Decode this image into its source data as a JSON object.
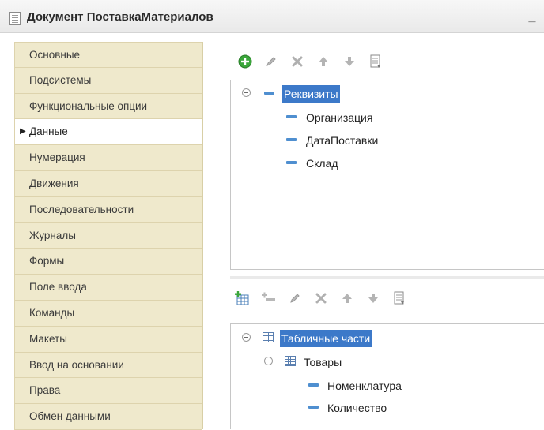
{
  "window": {
    "title": "Документ ПоставкаМатериалов",
    "minimize_glyph": "_"
  },
  "sidebar": {
    "active_index": 3,
    "items": [
      {
        "label": "Основные"
      },
      {
        "label": "Подсистемы"
      },
      {
        "label": "Функциональные опции"
      },
      {
        "label": "Данные"
      },
      {
        "label": "Нумерация"
      },
      {
        "label": "Движения"
      },
      {
        "label": "Последовательности"
      },
      {
        "label": "Журналы"
      },
      {
        "label": "Формы"
      },
      {
        "label": "Поле ввода"
      },
      {
        "label": "Команды"
      },
      {
        "label": "Макеты"
      },
      {
        "label": "Ввод на основании"
      },
      {
        "label": "Права"
      },
      {
        "label": "Обмен данными"
      }
    ]
  },
  "attributes_toolbar": {
    "buttons": [
      "add-icon",
      "edit-icon",
      "delete-icon",
      "move-up-icon",
      "move-down-icon",
      "sort-icon"
    ]
  },
  "attributes_tree": {
    "root": {
      "label": "Реквизиты",
      "selected": true
    },
    "children": [
      {
        "label": "Организация"
      },
      {
        "label": "ДатаПоставки"
      },
      {
        "label": "Склад"
      }
    ]
  },
  "tabular_toolbar": {
    "buttons": [
      "add-table-icon",
      "add-attribute-icon",
      "edit-icon",
      "delete-icon",
      "move-up-icon",
      "move-down-icon",
      "sort-icon"
    ]
  },
  "tabular_tree": {
    "root": {
      "label": "Табличные части",
      "selected": true
    },
    "table": {
      "label": "Товары"
    },
    "columns": [
      {
        "label": "Номенклатура"
      },
      {
        "label": "Количество"
      }
    ]
  },
  "colors": {
    "sidebar_bg": "#efe9cc",
    "selection": "#3c79c9",
    "accent_green": "#3aa63a"
  }
}
